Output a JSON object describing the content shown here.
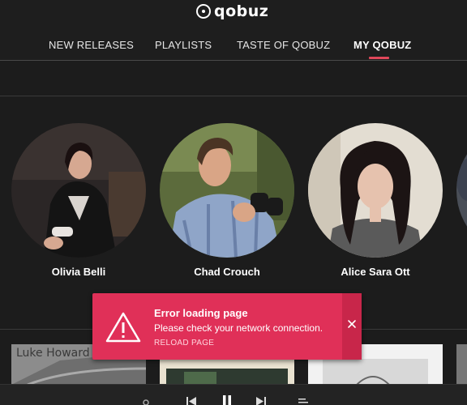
{
  "app": {
    "name": "qobuz"
  },
  "nav": {
    "items": [
      {
        "label": "NEW RELEASES"
      },
      {
        "label": "PLAYLISTS"
      },
      {
        "label": "TASTE OF QOBUZ"
      },
      {
        "label": "MY QOBUZ"
      }
    ],
    "active": "MY QOBUZ"
  },
  "artists": [
    {
      "name": "Olivia Belli"
    },
    {
      "name": "Chad Crouch"
    },
    {
      "name": "Alice Sara Ott"
    }
  ],
  "albums": [
    {
      "cover_text": "Luke Howard"
    }
  ],
  "toast": {
    "title": "Error loading page",
    "message": "Please check your network connection.",
    "action": "RELOAD PAGE",
    "icon": "warning-icon"
  },
  "colors": {
    "accent": "#e0475a",
    "toast_bg": "#e03058",
    "background": "#1c1c1c"
  }
}
